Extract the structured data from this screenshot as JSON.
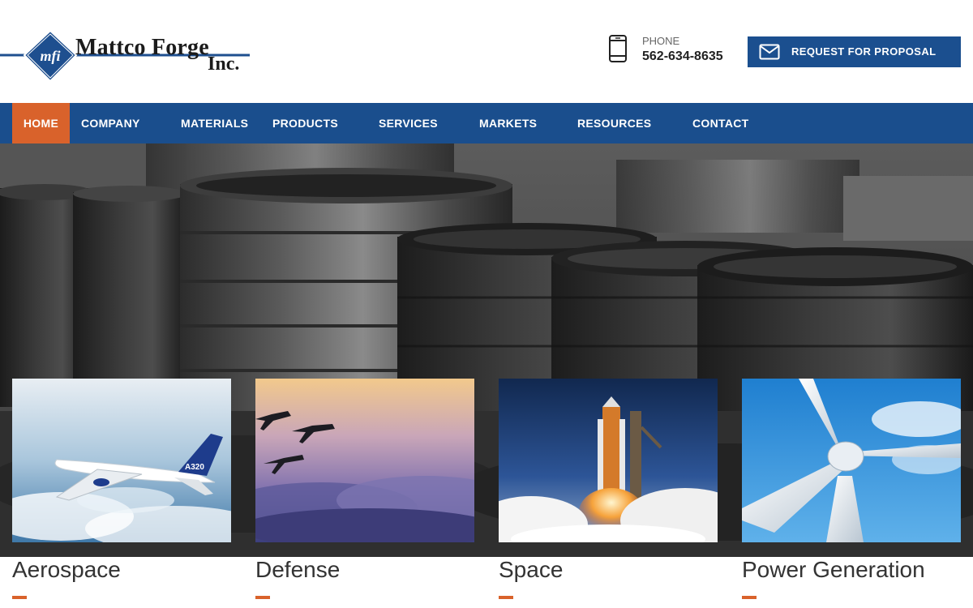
{
  "logo": {
    "badge": "mfi",
    "name": "Mattco Forge",
    "suffix": "Inc."
  },
  "contact": {
    "phone_label": "PHONE",
    "phone_number": "562-634-8635",
    "icon": "phone-icon"
  },
  "cta": {
    "label": "REQUEST FOR PROPOSAL",
    "icon": "envelope-icon"
  },
  "nav": {
    "items": [
      {
        "label": "HOME",
        "active": true
      },
      {
        "label": "COMPANY",
        "active": false
      },
      {
        "label": "MATERIALS",
        "active": false
      },
      {
        "label": "PRODUCTS",
        "active": false
      },
      {
        "label": "SERVICES",
        "active": false
      },
      {
        "label": "MARKETS",
        "active": false
      },
      {
        "label": "RESOURCES",
        "active": false
      },
      {
        "label": "CONTACT",
        "active": false
      }
    ]
  },
  "markets": [
    {
      "title": "Aerospace"
    },
    {
      "title": "Defense"
    },
    {
      "title": "Space"
    },
    {
      "title": "Power Generation"
    }
  ],
  "colors": {
    "brand_blue": "#1a4e8d",
    "accent_orange": "#d9622b"
  }
}
